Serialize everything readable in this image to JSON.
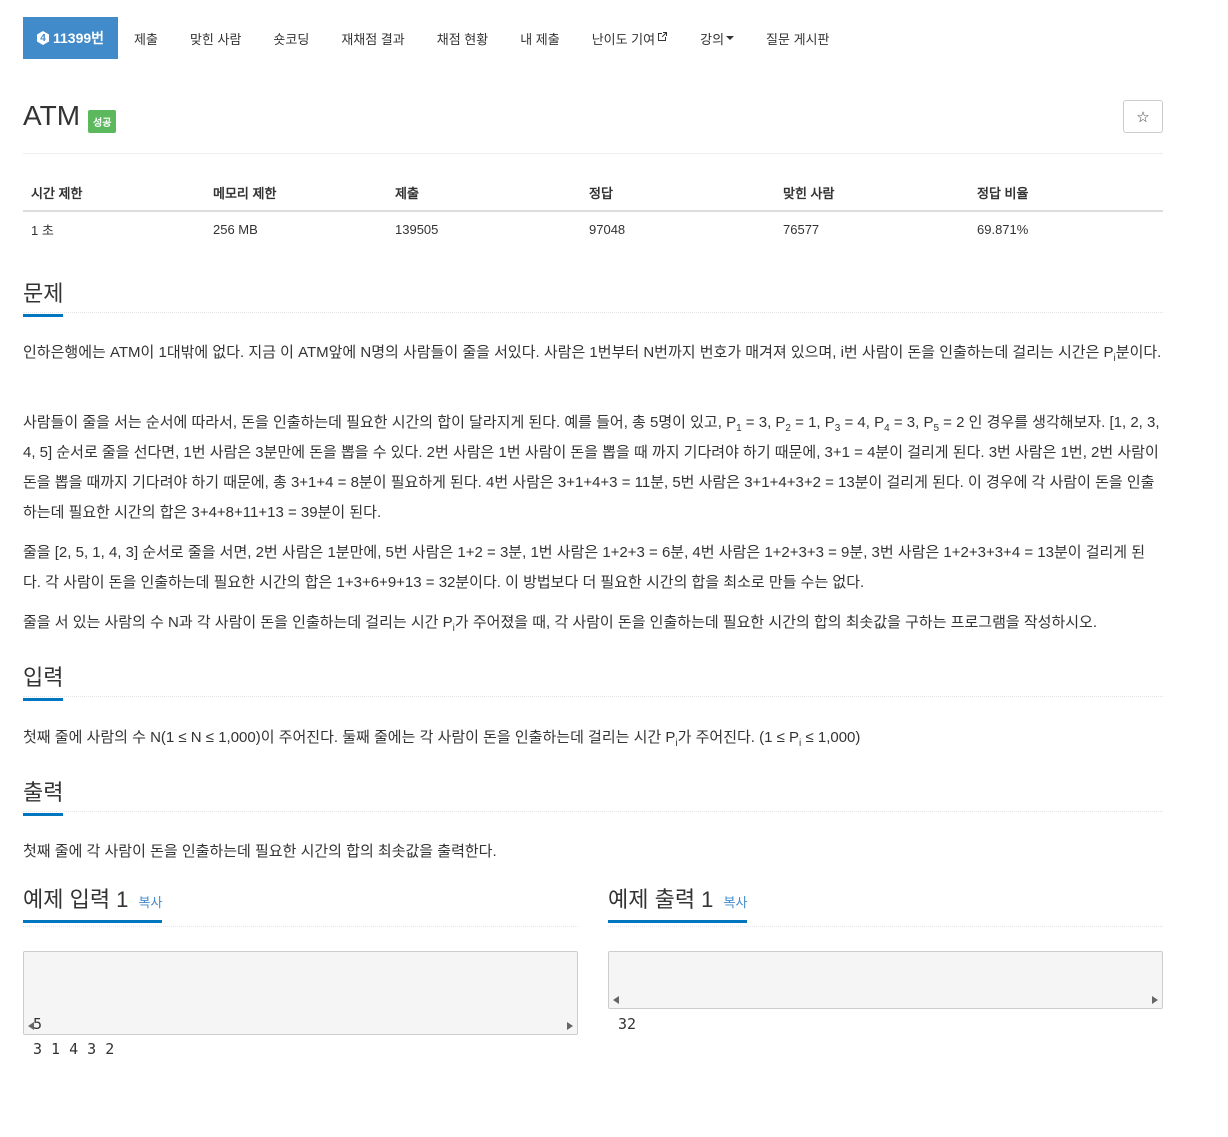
{
  "nav": {
    "active_tier": "4",
    "active_label": "11399번",
    "items": [
      "제출",
      "맞힌 사람",
      "숏코딩",
      "재채점 결과",
      "채점 현황",
      "내 제출",
      "난이도 기여",
      "강의",
      "질문 게시판"
    ]
  },
  "problem": {
    "title": "ATM",
    "status": "성공",
    "star_icon": "☆"
  },
  "info": {
    "headers": [
      "시간 제한",
      "메모리 제한",
      "제출",
      "정답",
      "맞힌 사람",
      "정답 비율"
    ],
    "values": [
      "1 초",
      "256 MB",
      "139505",
      "97048",
      "76577",
      "69.871%"
    ]
  },
  "sections": {
    "problem_heading": "문제",
    "input_heading": "입력",
    "output_heading": "출력"
  },
  "text": {
    "p1a": "인하은행에는 ATM이 1대밖에 없다. 지금 이 ATM앞에 N명의 사람들이 줄을 서있다. 사람은 1번부터 N번까지 번호가 매겨져 있으며, i번 사람이 돈을 인출하는데 걸리는 시간은 P",
    "p1b": "분이다.",
    "p2a": "사람들이 줄을 서는 순서에 따라서, 돈을 인출하는데 필요한 시간의 합이 달라지게 된다. 예를 들어, 총 5명이 있고, P",
    "p2b": " = 3, P",
    "p2c": " = 1, P",
    "p2d": " = 4, P",
    "p2e": " = 3, P",
    "p2f": " = 2 인 경우를 생각해보자. [1, 2, 3, 4, 5] 순서로 줄을 선다면, 1번 사람은 3분만에 돈을 뽑을 수 있다. 2번 사람은 1번 사람이 돈을 뽑을 때 까지 기다려야 하기 때문에, 3+1 = 4분이 걸리게 된다. 3번 사람은 1번, 2번 사람이 돈을 뽑을 때까지 기다려야 하기 때문에, 총 3+1+4 = 8분이 필요하게 된다. 4번 사람은 3+1+4+3 = 11분, 5번 사람은 3+1+4+3+2 = 13분이 걸리게 된다. 이 경우에 각 사람이 돈을 인출하는데 필요한 시간의 합은 3+4+8+11+13 = 39분이 된다.",
    "p3": "줄을 [2, 5, 1, 4, 3] 순서로 줄을 서면, 2번 사람은 1분만에, 5번 사람은 1+2 = 3분, 1번 사람은 1+2+3 = 6분, 4번 사람은 1+2+3+3 = 9분, 3번 사람은 1+2+3+3+4 = 13분이 걸리게 된다. 각 사람이 돈을 인출하는데 필요한 시간의 합은 1+3+6+9+13 = 32분이다. 이 방법보다 더 필요한 시간의 합을 최소로 만들 수는 없다.",
    "p4a": "줄을 서 있는 사람의 수 N과 각 사람이 돈을 인출하는데 걸리는 시간 P",
    "p4b": "가 주어졌을 때, 각 사람이 돈을 인출하는데 필요한 시간의 합의 최솟값을 구하는 프로그램을 작성하시오.",
    "input_a": "첫째 줄에 사람의 수 N(1 ≤ N ≤ 1,000)이 주어진다. 둘째 줄에는 각 사람이 돈을 인출하는데 걸리는 시간 P",
    "input_b": "가 주어진다. (1 ≤ P",
    "input_c": " ≤ 1,000)",
    "output": "첫째 줄에 각 사람이 돈을 인출하는데 필요한 시간의 합의 최솟값을 출력한다.",
    "sub_i": "i",
    "sub_1": "1",
    "sub_2": "2",
    "sub_3": "3",
    "sub_4": "4",
    "sub_5": "5"
  },
  "samples": {
    "input_title": "예제 입력 1",
    "output_title": "예제 출력 1",
    "copy_label": "복사",
    "input_value": "5\n3 1 4 3 2",
    "output_value": "32"
  },
  "colors": {
    "primary": "#428bca",
    "success": "#5cb85c",
    "section_underline": "#0076c0"
  }
}
